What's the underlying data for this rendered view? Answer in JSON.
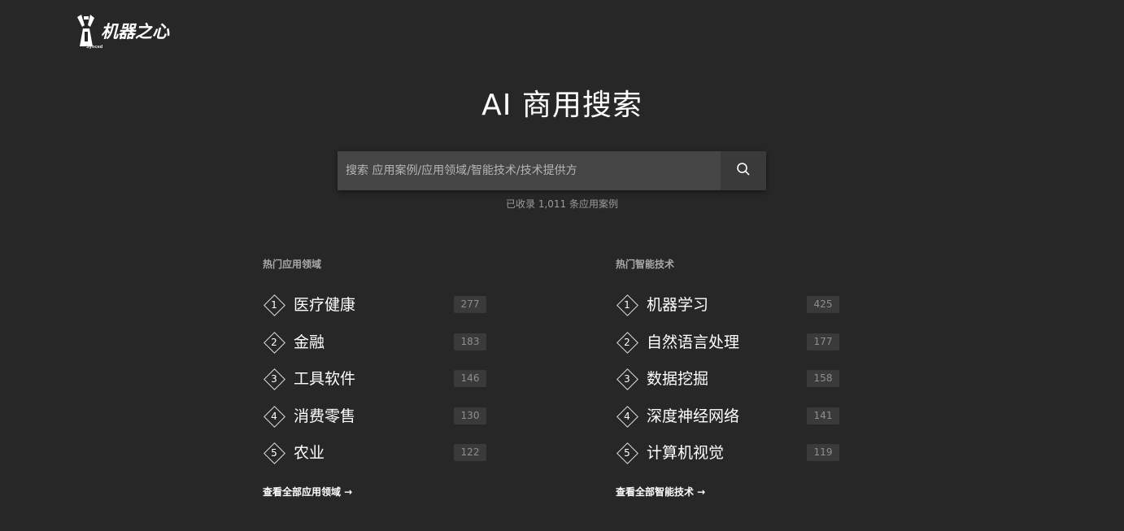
{
  "header": {
    "logo_text": "机器之心",
    "logo_sub": "Synced"
  },
  "hero": {
    "title": "AI 商用搜索"
  },
  "search": {
    "placeholder": "搜索 应用案例/应用领域/智能技术/技术提供方",
    "value": "",
    "button_icon": "search-icon",
    "count_text": "已收录 1,011 条应用案例"
  },
  "fields": {
    "title": "热门应用领域",
    "items": [
      {
        "rank": "1",
        "name": "医疗健康",
        "count": "277"
      },
      {
        "rank": "2",
        "name": "金融",
        "count": "183"
      },
      {
        "rank": "3",
        "name": "工具软件",
        "count": "146"
      },
      {
        "rank": "4",
        "name": "消费零售",
        "count": "130"
      },
      {
        "rank": "5",
        "name": "农业",
        "count": "122"
      }
    ],
    "view_all": "查看全部应用领域 →"
  },
  "tech": {
    "title": "热门智能技术",
    "items": [
      {
        "rank": "1",
        "name": "机器学习",
        "count": "425"
      },
      {
        "rank": "2",
        "name": "自然语言处理",
        "count": "177"
      },
      {
        "rank": "3",
        "name": "数据挖掘",
        "count": "158"
      },
      {
        "rank": "4",
        "name": "深度神经网络",
        "count": "141"
      },
      {
        "rank": "5",
        "name": "计算机视觉",
        "count": "119"
      }
    ],
    "view_all": "查看全部智能技术 →"
  },
  "colors": {
    "background": "#272727",
    "search_field": "#454545",
    "search_button": "#3a3a3a",
    "count_badge": "#3a3a3a",
    "text": "#ffffff",
    "muted_text": "#9b9b9b"
  }
}
